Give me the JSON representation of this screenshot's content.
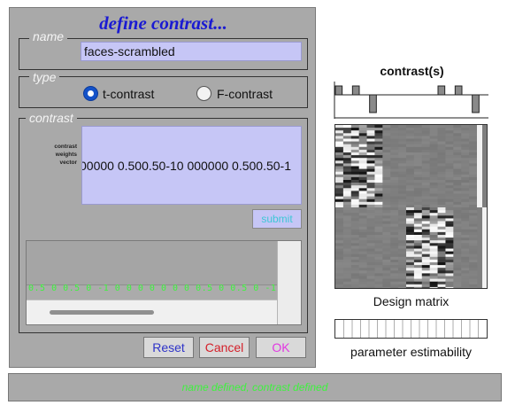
{
  "dialog": {
    "title": "define contrast...",
    "name_group": {
      "legend": "name",
      "value": "faces-scrambled"
    },
    "type_group": {
      "legend": "type",
      "options": [
        {
          "label": "t-contrast",
          "selected": true
        },
        {
          "label": "F-contrast",
          "selected": false
        }
      ]
    },
    "contrast_group": {
      "legend": "contrast",
      "weights_label_lines": [
        "contrast",
        "weights",
        "vector"
      ],
      "weights_value": "00000 0.500.50-10 000000 0.500.50-1",
      "submit_label": "submit",
      "weights_echo": "0.5 0 0.5 0 -1 0  0 0 0 0 0 0  0.5 0 0.5 0 -1 0"
    },
    "buttons": {
      "reset": "Reset",
      "cancel": "Cancel",
      "ok": "OK"
    }
  },
  "contrast_plot": {
    "title": "contrast(s)",
    "weights": [
      0.5,
      0,
      0.5,
      0,
      -1,
      0,
      0,
      0,
      0,
      0,
      0,
      0,
      0.5,
      0,
      0.5,
      0,
      -1,
      0
    ]
  },
  "design_matrix": {
    "caption": "Design matrix"
  },
  "estimability": {
    "caption": "parameter estimability",
    "columns": 18
  },
  "status": {
    "text": "name defined, contrast defined"
  },
  "colors": {
    "field_bg": "#c6c6f6",
    "status_text": "#3ef23e",
    "title_blue": "#1a1ad2",
    "reset_text": "#2e33c8",
    "cancel_text": "#d4202a",
    "ok_text": "#e238e2"
  }
}
